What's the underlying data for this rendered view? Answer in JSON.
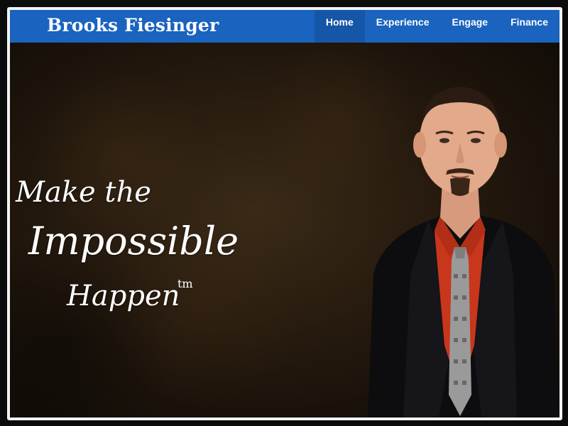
{
  "header": {
    "brand": "Brooks Fiesinger",
    "nav": [
      {
        "label": "Home",
        "active": true
      },
      {
        "label": "Experience",
        "active": false
      },
      {
        "label": "Engage",
        "active": false
      },
      {
        "label": "Finance",
        "active": false
      }
    ]
  },
  "hero": {
    "tagline_line1": "Make the",
    "tagline_line2": "Impossible",
    "tagline_line3": "Happen",
    "trademark": "tm",
    "portrait_icon": "person-portrait"
  },
  "colors": {
    "navbar": "#1a63bf",
    "nav_active": "#1656a8",
    "hero_bg": "#2a1d10",
    "shirt": "#c8361c",
    "suit": "#0d0d10",
    "frame_border": "#f2f2f2"
  }
}
